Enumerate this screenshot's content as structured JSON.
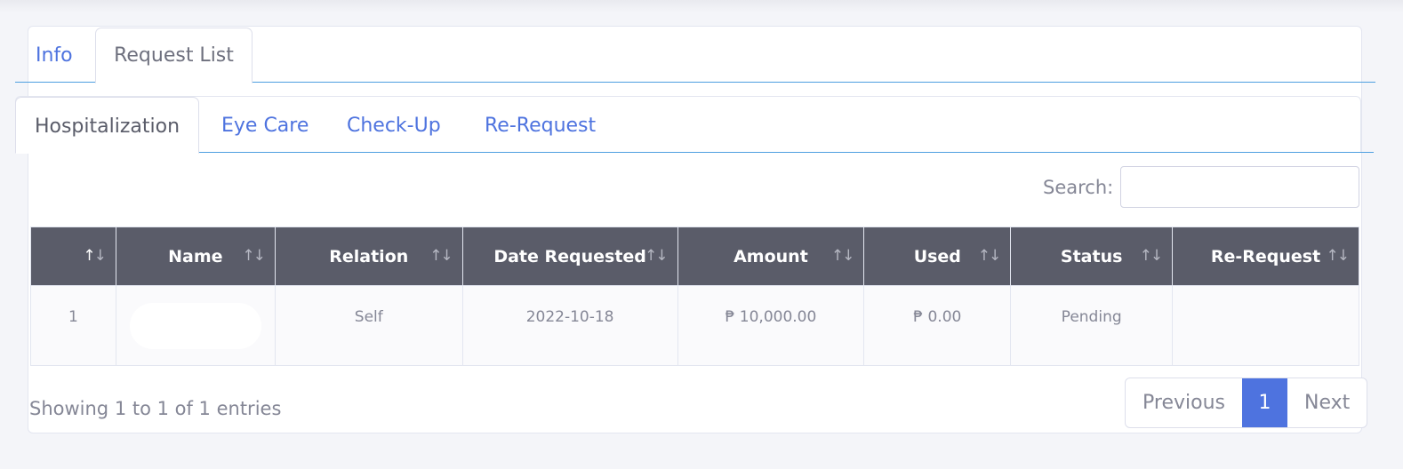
{
  "outer_tabs": [
    {
      "label": "Info",
      "active": false
    },
    {
      "label": "Request List",
      "active": true
    }
  ],
  "inner_tabs": [
    {
      "label": "Hospitalization",
      "active": true
    },
    {
      "label": "Eye Care",
      "active": false
    },
    {
      "label": "Check-Up",
      "active": false
    },
    {
      "label": "Re-Request",
      "active": false
    }
  ],
  "search": {
    "label": "Search:",
    "value": ""
  },
  "table": {
    "headers": [
      "",
      "Name",
      "Relation",
      "Date Requested",
      "Amount",
      "Used",
      "Status",
      "Re-Request"
    ],
    "rows": [
      {
        "no": "1",
        "name": "",
        "relation": "Self",
        "date": "2022-10-18",
        "amount": "₱ 10,000.00",
        "used": "₱ 0.00",
        "status": "Pending",
        "rerequest": ""
      }
    ]
  },
  "footer": {
    "info": "Showing 1 to 1 of 1 entries"
  },
  "pagination": {
    "previous": "Previous",
    "current": "1",
    "next": "Next"
  },
  "icons": {
    "sort": "sort-arrows-icon"
  },
  "colors": {
    "accent": "#4e73df",
    "header_bg": "#5a5c69",
    "tab_line": "#4e9fe0"
  }
}
